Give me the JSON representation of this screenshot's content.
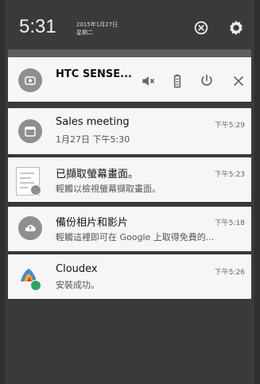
{
  "status_bar": {
    "time": "5:31",
    "date_line1": "2015年1月27日",
    "date_line2": "星期二"
  },
  "quick_actions": {
    "title": "HTC SENSE...",
    "icons": [
      "volume-off-icon",
      "battery-icon",
      "power-icon",
      "close-icon"
    ]
  },
  "notifications": [
    {
      "title": "Sales meeting",
      "subtitle": "1月27日 下午5:30",
      "time": "下午5:29",
      "icon": "calendar-icon"
    },
    {
      "title": "已擷取螢幕畫面。",
      "subtitle": "輕觸以檢視螢幕擷取畫面。",
      "time": "下午5:23",
      "icon": "screenshot-thumbnail"
    },
    {
      "title": "備份相片和影片",
      "subtitle": "輕觸這裡即可在 Google 上取得免費的...",
      "time": "下午5:18",
      "icon": "cloud-upload-icon"
    },
    {
      "title": "Cloudex",
      "subtitle": "安裝成功。",
      "time": "下午5:26",
      "icon": "cloudex-app-icon"
    }
  ],
  "colors": {
    "shade_bg": "#3a3a3a",
    "card_bg": "#f6f6f6",
    "icon_gray": "#8f8f8f",
    "cloud_blue": "#4a86d6",
    "install_green": "#2aa75b"
  }
}
